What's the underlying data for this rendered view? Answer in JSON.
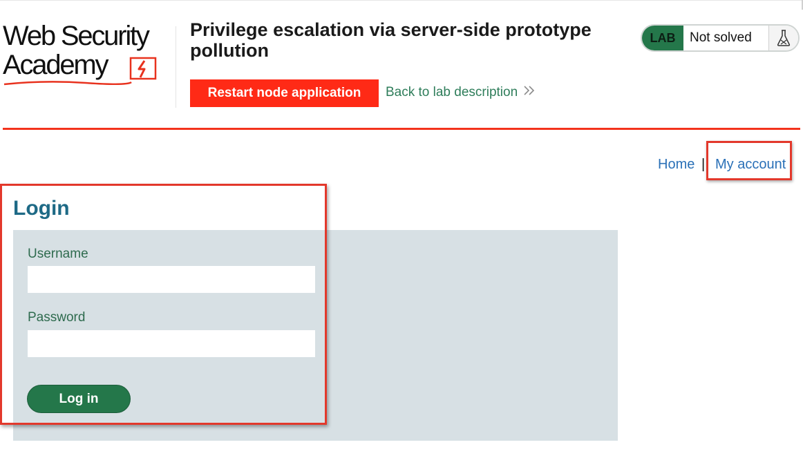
{
  "logo": {
    "line1": "Web Security",
    "line2": "Academy"
  },
  "lab": {
    "title": "Privilege escalation via server-side prototype pollution",
    "restart_label": "Restart node application",
    "back_label": "Back to lab description",
    "back_chevron": "»",
    "badge_label": "LAB",
    "status": "Not solved"
  },
  "nav": {
    "home": "Home",
    "separator": "|",
    "account": "My account"
  },
  "login": {
    "heading": "Login",
    "username_label": "Username",
    "username_value": "",
    "password_label": "Password",
    "password_value": "",
    "submit_label": "Log in"
  },
  "colors": {
    "accent_red": "#ff2a16",
    "brand_green": "#24774a",
    "link_blue": "#2a70b7",
    "panel_bg": "#d7e0e4",
    "highlight_red": "#e3382b"
  },
  "icons": {
    "flask": "flask-icon",
    "chevron": "double-chevron-right-icon",
    "logo_flag": "academy-flag-icon"
  }
}
